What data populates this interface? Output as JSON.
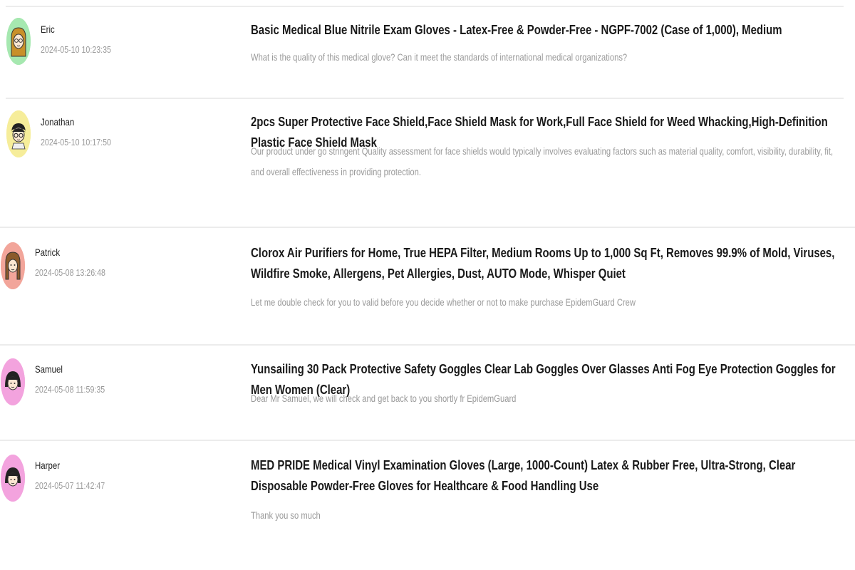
{
  "entries": [
    {
      "user": "Eric",
      "timestamp": "2024-05-10 10:23:35",
      "avatar_bg": "#a6e8b0",
      "avatar_icon": "avatar-long-hair-glasses-icon",
      "product": "Basic Medical Blue Nitrile Exam Gloves - Latex-Free & Powder-Free - NGPF-7002 (Case of 1,000), Medium",
      "message": "What is the quality of this medical glove? Can it meet the standards of international medical organizations?"
    },
    {
      "user": "Jonathan",
      "timestamp": "2024-05-10 10:17:50",
      "avatar_bg": "#f6ed9a",
      "avatar_icon": "avatar-glasses-icon",
      "product": "2pcs Super Protective Face Shield,Face Shield Mask for Work,Full Face Shield for Weed Whacking,High-Definition Plastic Face Shield Mask",
      "message": "Our product under go stringent Quality assessment for face shields would typically involves evaluating factors such as material quality, comfort, visibility, durability, fit, and overall effectiveness in providing protection."
    },
    {
      "user": "Patrick",
      "timestamp": "2024-05-08 13:26:48",
      "avatar_bg": "#f2a59a",
      "avatar_icon": "avatar-braids-icon",
      "product": "Clorox Air Purifiers for Home, True HEPA Filter, Medium Rooms Up to 1,000 Sq Ft, Removes 99.9% of Mold, Viruses, Wildfire Smoke, Allergens, Pet Allergies, Dust, AUTO Mode, Whisper Quiet",
      "message": "Let me double check for you to valid before you decide whether or not to make purchase EpidemGuard Crew"
    },
    {
      "user": "Samuel",
      "timestamp": "2024-05-08 11:59:35",
      "avatar_bg": "#f3a3de",
      "avatar_icon": "avatar-bob-hair-icon",
      "product": "Yunsailing 30 Pack Protective Safety Goggles Clear Lab Goggles Over Glasses Anti Fog Eye Protection Goggles for Men Women (Clear)",
      "message": "Dear Mr Samuel, we will check and get back to you shortly fr EpidemGuard"
    },
    {
      "user": "Harper",
      "timestamp": "2024-05-07 11:42:47",
      "avatar_bg": "#f3a3de",
      "avatar_icon": "avatar-bob-hair-icon",
      "product": "MED PRIDE Medical Vinyl Examination Gloves (Large, 1000-Count) Latex & Rubber Free, Ultra-Strong, Clear Disposable Powder-Free Gloves for Healthcare & Food Handling Use",
      "message": "Thank you so much"
    }
  ]
}
